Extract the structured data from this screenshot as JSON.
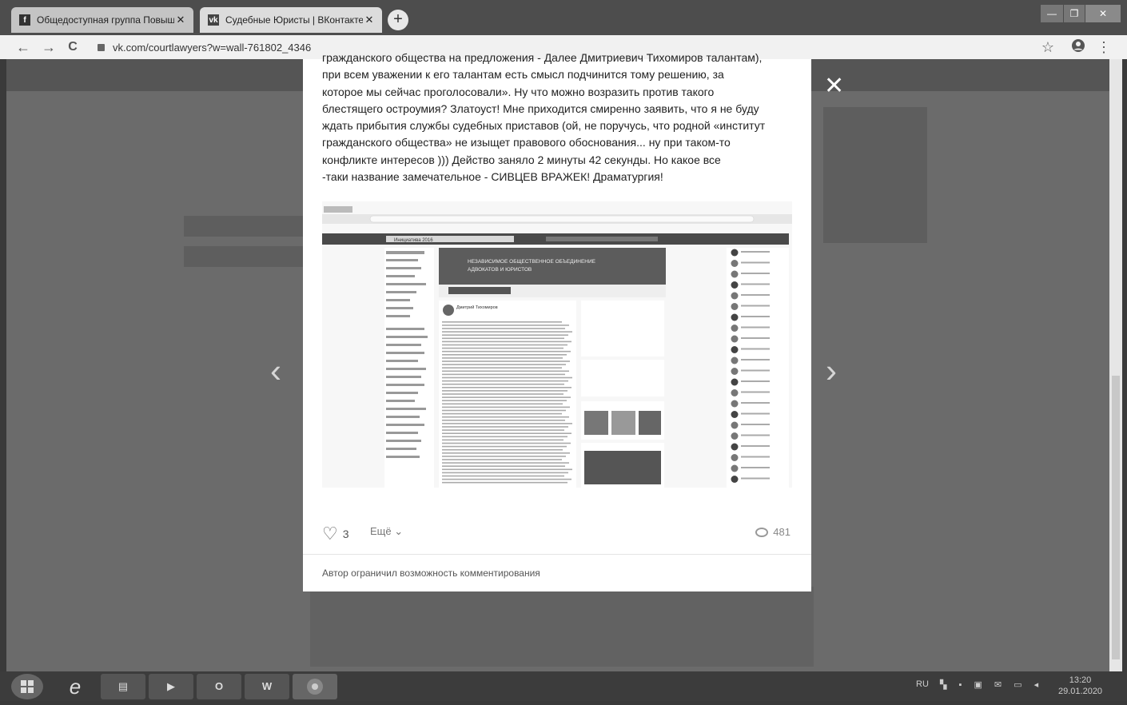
{
  "browser": {
    "tabs": [
      {
        "favicon": "facebook-icon",
        "label": "Общедоступная группа Повыш",
        "close": "✕"
      },
      {
        "favicon": "vk-icon",
        "label": "Судебные Юристы | ВКонтакте",
        "close": "✕"
      }
    ],
    "new_tab": "+",
    "window_controls": {
      "minimize": "—",
      "maximize": "❐",
      "close": "✕"
    },
    "url": "vk.com/courtlawyers?w=wall-761802_4346",
    "nav": {
      "back": "←",
      "forward": "→",
      "reload": "C",
      "star": "☆",
      "menu": "⋮"
    }
  },
  "viewer": {
    "close": "✕",
    "prev": "‹",
    "next": "›"
  },
  "post": {
    "lines": [
      "гражданского общества на предложения - Далее Дмитриевич Тихомиров талантам),",
      "при всем уважении к его талантам есть смысл подчинится тому решению, за",
      "которое мы сейчас проголосовали». Ну что можно возразить против такого",
      "блестящего остроумия? Златоуст! Мне приходится смиренно заявить, что я не буду",
      "ждать прибытия службы судебных приставов (ой, не поручусь, что родной «институт",
      "гражданского общества» не изыщет правового обоснования... ну при таком-то",
      "конфликте интересов ))) Действо заняло 2 минуты 42 секунды. Но какое все",
      "-таки название замечательное - СИВЦЕВ ВРАЖЕК! Драматургия!"
    ],
    "screenshot": {
      "header_title": "Инициатива 2016",
      "banner": [
        "НЕЗАВИСИМОЕ ОБЩЕСТВЕННОЕ ОБЪЕДИНЕНИЕ",
        "АДВОКАТОВ И ЮРИСТОВ"
      ],
      "author": "Дмитрий Тихомиров"
    },
    "likes": "3",
    "more": "Ещё",
    "views": "481",
    "comment_note": "Автор ограничил возможность комментирования"
  },
  "taskbar": {
    "lang": "RU",
    "time": "13:20",
    "date": "29.01.2020"
  }
}
